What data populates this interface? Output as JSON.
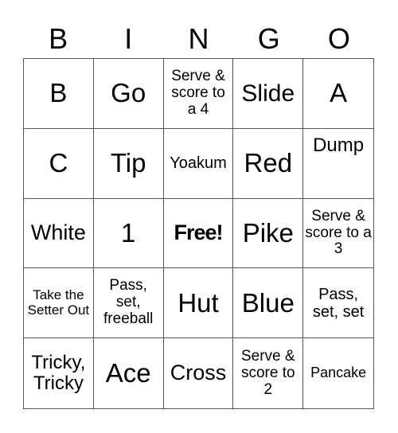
{
  "header": [
    "B",
    "I",
    "N",
    "G",
    "O"
  ],
  "cells": [
    [
      "B",
      "Go",
      "Serve & score to a 4",
      "Slide",
      "A"
    ],
    [
      "C",
      "Tip",
      "Yoakum",
      "Red",
      "Dump"
    ],
    [
      "White",
      "1",
      "Free!",
      "Pike",
      "Serve & score to a 3"
    ],
    [
      "Take the Setter Out",
      "Pass, set, freeball",
      "Hut",
      "Blue",
      "Pass, set, set"
    ],
    [
      "Tricky, Tricky",
      "Ace",
      "Cross",
      "Serve & score to 2",
      "Pancake"
    ]
  ]
}
